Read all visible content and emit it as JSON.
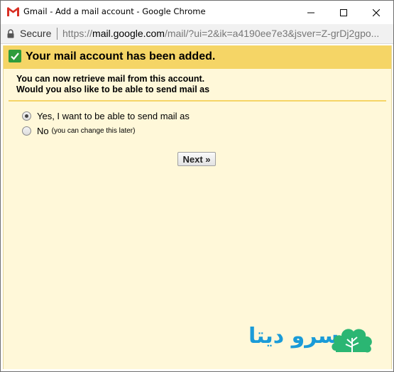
{
  "window": {
    "title": "Gmail - Add a mail account - Google Chrome"
  },
  "addressbar": {
    "secure_label": "Secure",
    "url_prefix": "https://",
    "url_host": "mail.google.com",
    "url_rest": "/mail/?ui=2&ik=a4190ee7e3&jsver=Z-grDj2gpo..."
  },
  "dialog": {
    "header_title": "Your mail account has been added.",
    "intro_line1": "You can now retrieve mail from this account.",
    "intro_line2": "Would you also like to be able to send mail as",
    "options": [
      {
        "label": "Yes, I want to be able to send mail as",
        "note": "",
        "checked": true
      },
      {
        "label": "No",
        "note": "(you can change this later)",
        "checked": false
      }
    ],
    "next_label": "Next »"
  },
  "watermark": {
    "text": "سرو دیتا"
  },
  "colors": {
    "header_bar": "#f5d566",
    "panel_bg": "#fff8d9",
    "check_green": "#2e9c3b",
    "watermark_blue": "#1a9bd8"
  }
}
